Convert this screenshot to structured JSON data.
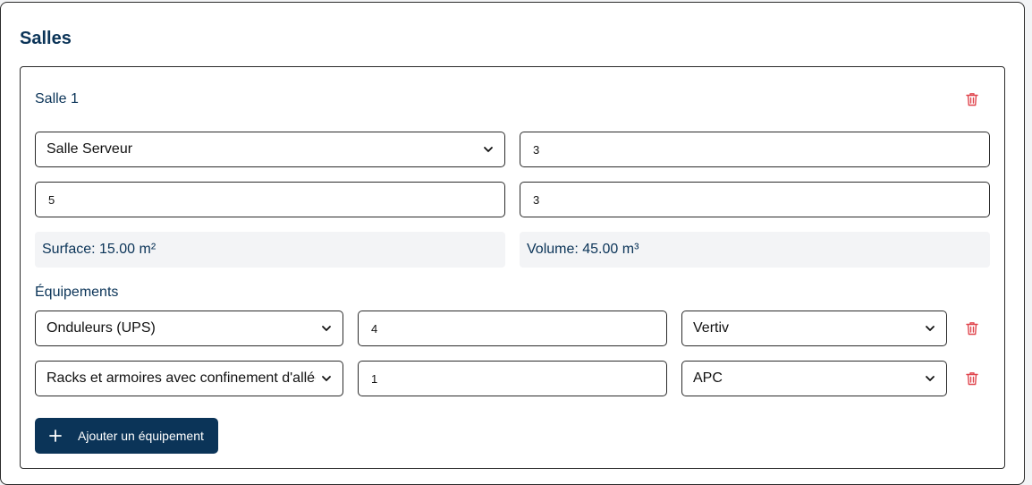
{
  "section": {
    "title": "Salles"
  },
  "room": {
    "title": "Salle 1",
    "type_select": "Salle Serveur",
    "field_top_right": "3",
    "field_mid_left": "5",
    "field_mid_right": "3",
    "surface": "Surface: 15.00 m²",
    "volume": "Volume: 45.00 m³"
  },
  "equipment": {
    "heading": "Équipements",
    "rows": [
      {
        "type": "Onduleurs (UPS)",
        "quantity": "4",
        "brand": "Vertiv"
      },
      {
        "type": "Racks et armoires avec confinement d'allée",
        "quantity": "1",
        "brand": "APC"
      }
    ],
    "add_label": "Ajouter un équipement"
  },
  "colors": {
    "brand": "#0b3458",
    "danger": "#e0464e",
    "info_bg": "#f3f4f6"
  },
  "icons": {
    "delete": "trash-icon",
    "dropdown": "chevron-down-icon",
    "add": "plus-icon"
  }
}
